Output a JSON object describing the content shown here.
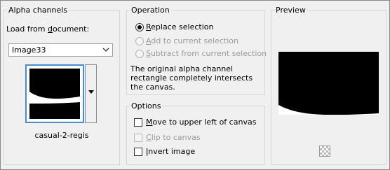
{
  "alpha_channels": {
    "title": "Alpha channels",
    "load_label_pre": "Load from ",
    "load_label_key": "d",
    "load_label_post": "ocument:",
    "document_value": "Image33",
    "channel_name": "casual-2-regis"
  },
  "operation": {
    "title": "Operation",
    "options": [
      {
        "key": "R",
        "rest": "eplace selection",
        "selected": true,
        "enabled": true
      },
      {
        "key": "A",
        "rest": "dd to current selection",
        "selected": false,
        "enabled": false
      },
      {
        "key": "S",
        "rest": "ubtract from current selection",
        "selected": false,
        "enabled": false
      }
    ],
    "description": "The original alpha channel rectangle completely intersects the canvas."
  },
  "options": {
    "title": "Options",
    "items": [
      {
        "key": "M",
        "rest": "ove to upper left of canvas",
        "checked": false,
        "enabled": true
      },
      {
        "key": "C",
        "rest": "lip to canvas",
        "checked": false,
        "enabled": false
      },
      {
        "key": "I",
        "rest": "nvert image",
        "checked": false,
        "enabled": true
      }
    ]
  },
  "preview": {
    "title": "Preview"
  },
  "colors": {
    "thumb_border": "#3f8fe0",
    "mask_black": "#000000",
    "mask_white": "#ffffff"
  }
}
